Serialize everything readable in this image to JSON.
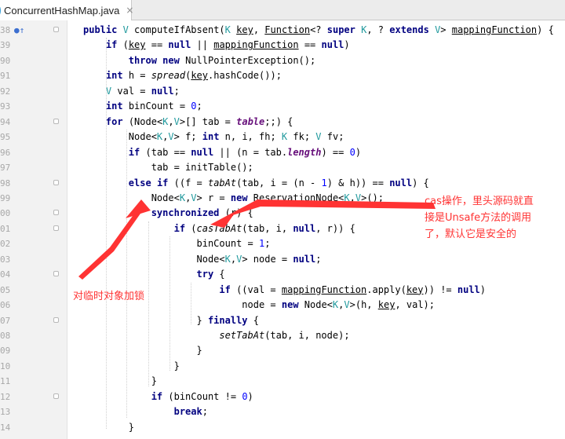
{
  "tab": {
    "filename": "ConcurrentHashMap.java",
    "close_symbol": "×"
  },
  "lines": [
    {
      "num": "38",
      "code": "public V computeIfAbsent(K key, Function<? super K, ? extends V> mappingFunction) {"
    },
    {
      "num": "39",
      "code": "    if (key == null || mappingFunction == null)"
    },
    {
      "num": "90",
      "code": "        throw new NullPointerException();"
    },
    {
      "num": "91",
      "code": "    int h = spread(key.hashCode());"
    },
    {
      "num": "92",
      "code": "    V val = null;"
    },
    {
      "num": "93",
      "code": "    int binCount = 0;"
    },
    {
      "num": "94",
      "code": "    for (Node<K,V>[] tab = table;;) {"
    },
    {
      "num": "95",
      "code": "        Node<K,V> f; int n, i, fh; K fk; V fv;"
    },
    {
      "num": "96",
      "code": "        if (tab == null || (n = tab.length) == 0)"
    },
    {
      "num": "97",
      "code": "            tab = initTable();"
    },
    {
      "num": "98",
      "code": "        else if ((f = tabAt(tab, i = (n - 1) & h)) == null) {"
    },
    {
      "num": "99",
      "code": "            Node<K,V> r = new ReservationNode<K,V>();"
    },
    {
      "num": "00",
      "code": "            synchronized (r) {"
    },
    {
      "num": "01",
      "code": "                if (casTabAt(tab, i, null, r)) {"
    },
    {
      "num": "02",
      "code": "                    binCount = 1;"
    },
    {
      "num": "03",
      "code": "                    Node<K,V> node = null;"
    },
    {
      "num": "04",
      "code": "                    try {"
    },
    {
      "num": "05",
      "code": "                        if ((val = mappingFunction.apply(key)) != null)"
    },
    {
      "num": "06",
      "code": "                            node = new Node<K,V>(h, key, val);"
    },
    {
      "num": "07",
      "code": "                    } finally {"
    },
    {
      "num": "08",
      "code": "                        setTabAt(tab, i, node);"
    },
    {
      "num": "09",
      "code": "                    }"
    },
    {
      "num": "10",
      "code": "                }"
    },
    {
      "num": "11",
      "code": "            }"
    },
    {
      "num": "12",
      "code": "            if (binCount != 0)"
    },
    {
      "num": "13",
      "code": "                break;"
    },
    {
      "num": "14",
      "code": "        }"
    }
  ],
  "annotations": {
    "cas_note_line1": "cas操作，里头源码就直",
    "cas_note_line2": "接是Unsafe方法的调用",
    "cas_note_line3": "了，默认它是安全的",
    "lock_note": "对临时对象加锁"
  },
  "colors": {
    "annotation": "#ff3333",
    "keyword": "#000080",
    "field": "#660e7a",
    "number": "#0000ff"
  }
}
